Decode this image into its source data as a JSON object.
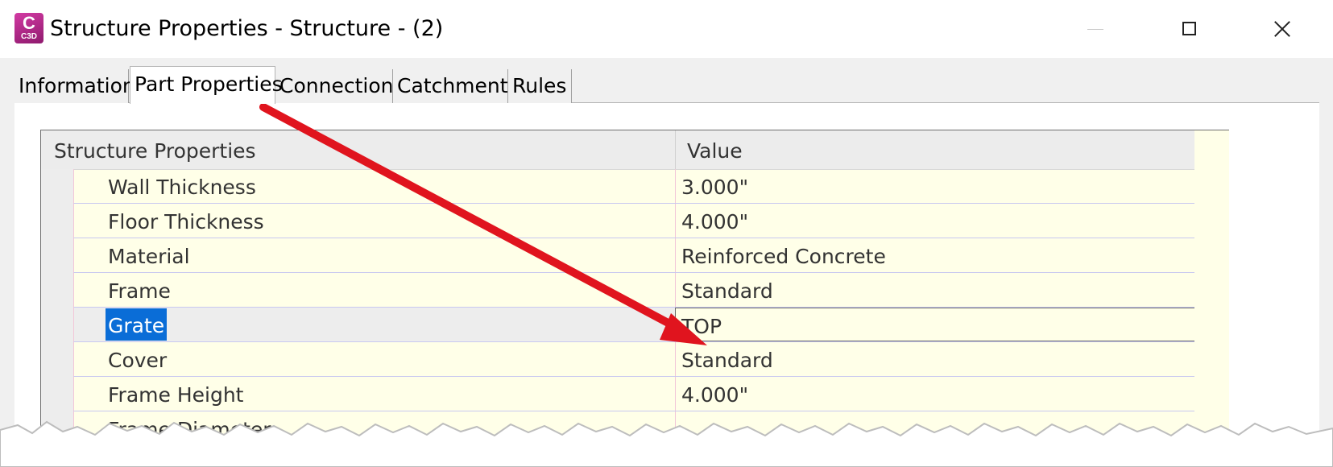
{
  "window": {
    "title": "Structure Properties - Structure - (2)",
    "app_icon_letter": "C",
    "app_icon_caption": "C3D"
  },
  "tabs": [
    {
      "label": "Information",
      "active": false
    },
    {
      "label": "Part Properties",
      "active": true
    },
    {
      "label": "Connections",
      "active": false
    },
    {
      "label": "Catchments",
      "active": false
    },
    {
      "label": "Rules",
      "active": false
    }
  ],
  "grid": {
    "columns": [
      "Structure Properties",
      "Value"
    ],
    "rows": [
      {
        "name": "Wall Thickness",
        "value": "3.000\""
      },
      {
        "name": "Floor Thickness",
        "value": "4.000\""
      },
      {
        "name": "Material",
        "value": "Reinforced Concrete"
      },
      {
        "name": "Frame",
        "value": "Standard"
      },
      {
        "name": "Grate",
        "value": "TOP",
        "selected": true
      },
      {
        "name": "Cover",
        "value": "Standard"
      },
      {
        "name": "Frame Height",
        "value": "4.000\""
      },
      {
        "name": "Frame Diameter",
        "value": ""
      }
    ]
  },
  "colors": {
    "grid_background": "#ffffe8",
    "selection": "#0a6dd7",
    "annotation_arrow": "#e0141e",
    "app_icon": "#b72a8c"
  }
}
